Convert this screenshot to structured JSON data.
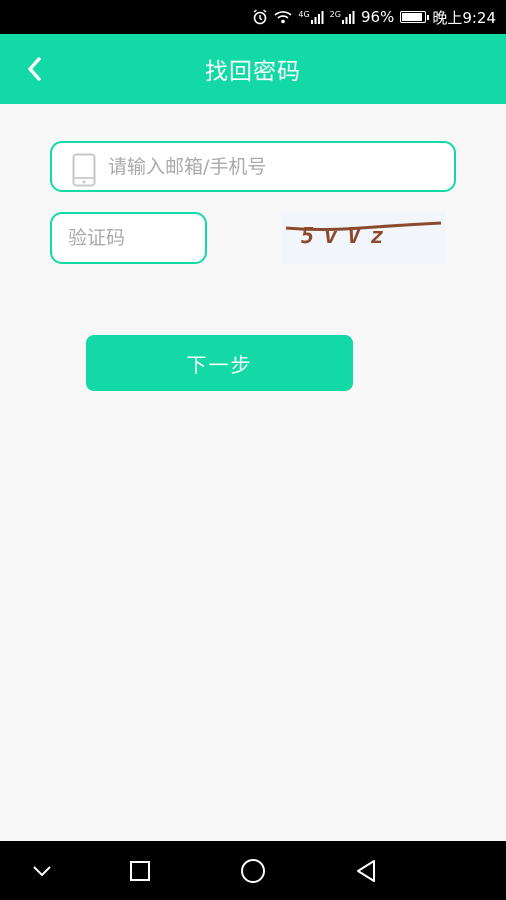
{
  "status_bar": {
    "network_1": "4G",
    "network_2": "2G",
    "battery": "96%",
    "battery_level": 0.96,
    "time": "晚上9:24"
  },
  "header": {
    "title": "找回密码",
    "back_icon": "chevron-left-icon"
  },
  "form": {
    "account_placeholder": "请输入邮箱/手机号",
    "account_value": "",
    "account_icon": "phone-icon",
    "code_placeholder": "验证码",
    "code_value": "",
    "captcha_text": "5vVz",
    "next_label": "下一步"
  },
  "nav": {
    "back": "chevron-down-icon",
    "home": "circle-icon",
    "recent": "square-icon",
    "triangle": "triangle-back-icon"
  },
  "colors": {
    "accent": "#12d9a6",
    "background": "#f8f8f8",
    "captcha_ink": "#8b4a2e"
  }
}
